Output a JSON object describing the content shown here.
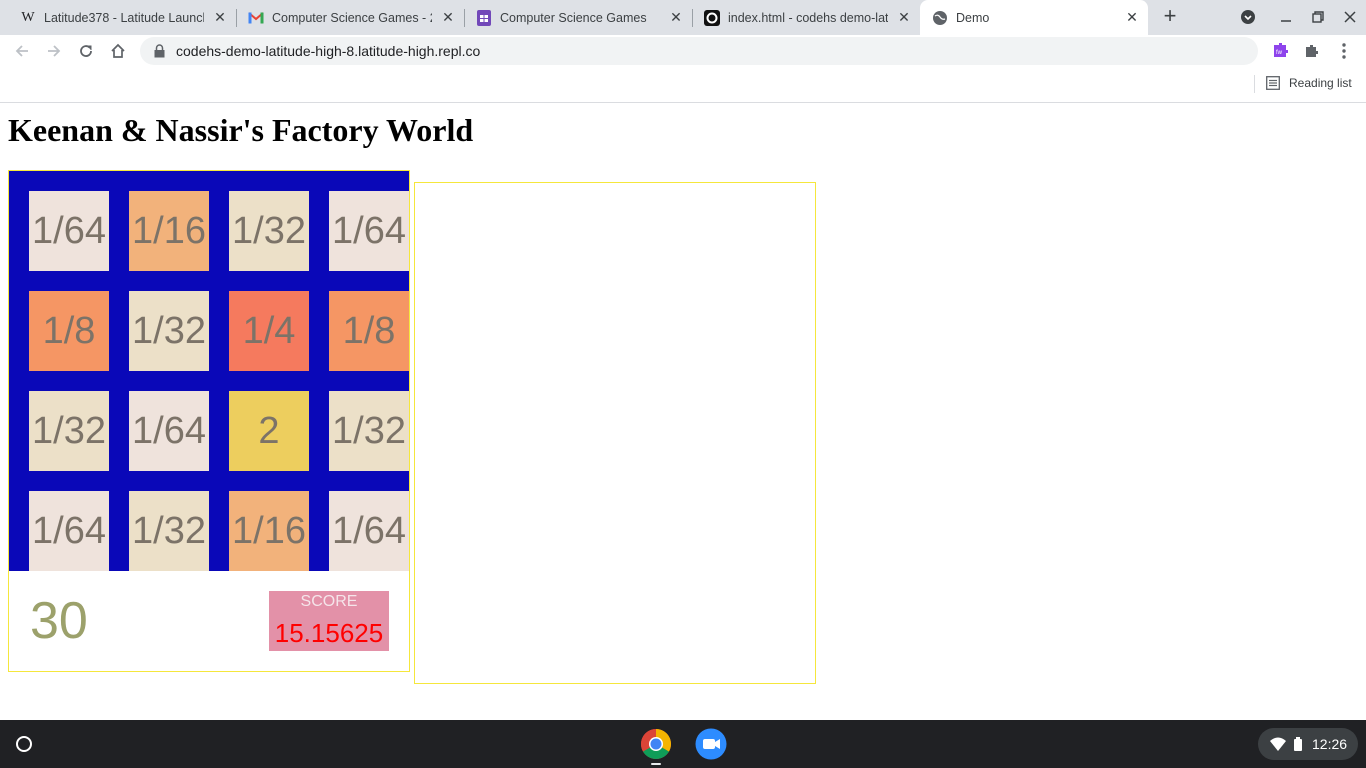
{
  "browser": {
    "tabs": [
      {
        "title": "Latitude378 - Latitude Launch",
        "icon": "wikipedia-icon",
        "active": false
      },
      {
        "title": "Computer Science Games - 28",
        "icon": "gmail-icon",
        "active": false
      },
      {
        "title": "Computer Science Games",
        "icon": "google-sheets-icon",
        "active": false
      },
      {
        "title": "index.html - codehs demo-latit",
        "icon": "replit-icon",
        "active": false
      },
      {
        "title": "Demo",
        "icon": "globe-icon",
        "active": true
      }
    ],
    "url": "codehs-demo-latitude-high-8.latitude-high.repl.co",
    "reading_list_label": "Reading list"
  },
  "page": {
    "title": "Keenan & Nassir's Factory World",
    "board": [
      [
        {
          "v": "1/64",
          "c": "#efe3dc"
        },
        {
          "v": "1/16",
          "c": "#f2b27b"
        },
        {
          "v": "1/32",
          "c": "#ece0c8"
        },
        {
          "v": "1/64",
          "c": "#efe3dc"
        }
      ],
      [
        {
          "v": "1/8",
          "c": "#f59664"
        },
        {
          "v": "1/32",
          "c": "#ece0c8"
        },
        {
          "v": "1/4",
          "c": "#f57a5e"
        },
        {
          "v": "1/8",
          "c": "#f59664"
        }
      ],
      [
        {
          "v": "1/32",
          "c": "#ece0c8"
        },
        {
          "v": "1/64",
          "c": "#efe3dc"
        },
        {
          "v": "2",
          "c": "#edce5e"
        },
        {
          "v": "1/32",
          "c": "#ece0c8"
        }
      ],
      [
        {
          "v": "1/64",
          "c": "#efe3dc"
        },
        {
          "v": "1/32",
          "c": "#ece0c8"
        },
        {
          "v": "1/16",
          "c": "#f2b27b"
        },
        {
          "v": "1/64",
          "c": "#efe3dc"
        }
      ]
    ],
    "counter": "30",
    "score_label": "SCORE",
    "score_value": "15.15625"
  },
  "shelf": {
    "time": "12:26",
    "apps": [
      "chrome-icon",
      "zoom-icon"
    ]
  },
  "colors": {
    "board_bg": "#0a08b8",
    "panel_border": "#f5e73c",
    "score_bg": "#e391a8",
    "score_value": "#ff0000"
  }
}
